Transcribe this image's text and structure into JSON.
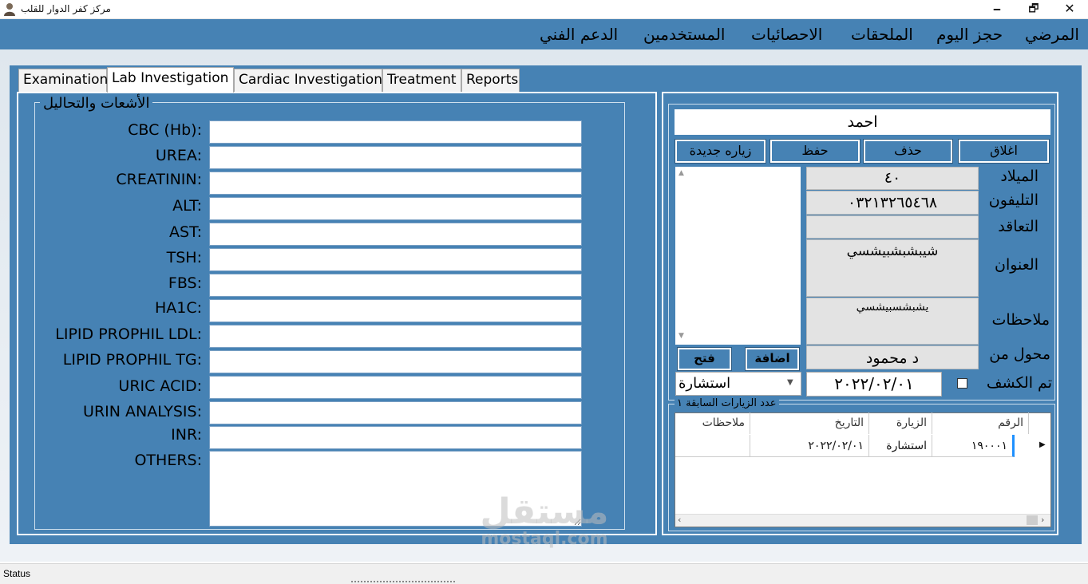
{
  "window": {
    "title": "مركز كفر الدوار للقلب",
    "minimize": "🗕",
    "maximize": "🗗",
    "close": "✕"
  },
  "menu": {
    "items": [
      {
        "label": "المرضي"
      },
      {
        "label": "حجز اليوم"
      },
      {
        "label": "الملحقات"
      },
      {
        "label": "الاحصائيات"
      },
      {
        "label": "المستخدمين"
      },
      {
        "label": "الدعم الفني"
      }
    ]
  },
  "tabs": [
    {
      "label": "Examination"
    },
    {
      "label": "Lab Investigation"
    },
    {
      "label": "Cardiac Investigation"
    },
    {
      "label": "Treatment"
    },
    {
      "label": "Reports"
    }
  ],
  "lab": {
    "legend": "الأشعات والتحاليل",
    "fields": [
      {
        "label": "CBC (Hb):",
        "value": ""
      },
      {
        "label": "UREA:",
        "value": ""
      },
      {
        "label": "CREATININ:",
        "value": ""
      },
      {
        "label": "ALT:",
        "value": ""
      },
      {
        "label": "AST:",
        "value": ""
      },
      {
        "label": "TSH:",
        "value": ""
      },
      {
        "label": "FBS:",
        "value": ""
      },
      {
        "label": "HA1C:",
        "value": ""
      },
      {
        "label": "LIPID PROPHIL LDL:",
        "value": ""
      },
      {
        "label": "LIPID PROPHIL TG:",
        "value": ""
      },
      {
        "label": "URIC ACID:",
        "value": ""
      },
      {
        "label": "URIN ANALYSIS:",
        "value": ""
      },
      {
        "label": "INR:",
        "value": ""
      },
      {
        "label": "OTHERS:",
        "value": ""
      }
    ]
  },
  "patient": {
    "name": "احمد",
    "buttons": {
      "close": "اغلاق",
      "delete": "حذف",
      "save": "حفظ",
      "new_visit": "زياره جديدة",
      "add": "اضافة",
      "open": "فتح"
    },
    "labels": {
      "birth": "الميلاد",
      "phone": "التليفون",
      "contract": "التعاقد",
      "address": "العنوان",
      "notes": "ملاحظات",
      "referred_by": "محول من",
      "examined": "تم الكشف"
    },
    "values": {
      "birth": "٤٠",
      "phone": "٠٣٢١٣٢٦٥٤٦٨",
      "contract": "",
      "address": "شيبشبشبيشسي",
      "notes": "يشبشسبيشسي",
      "referred_by": "د محمود",
      "visit_type": "استشارة",
      "visit_date": "٢٠٢٢/٠٢/٠١",
      "examined": false
    }
  },
  "visits": {
    "legend": "عدد الزيارات السابقة ١",
    "headers": {
      "number": "الرقم",
      "visit": "الزيارة",
      "date": "التاريخ",
      "notes": "ملاحظات"
    },
    "rows": [
      {
        "number": "١٩٠٠٠١",
        "visit": "استشارة",
        "date": "٢٠٢٢/٠٢/٠١",
        "notes": ""
      }
    ]
  },
  "watermark": {
    "ar": "مستقل",
    "en": "mostaql.com"
  },
  "status": {
    "text": "Status"
  }
}
